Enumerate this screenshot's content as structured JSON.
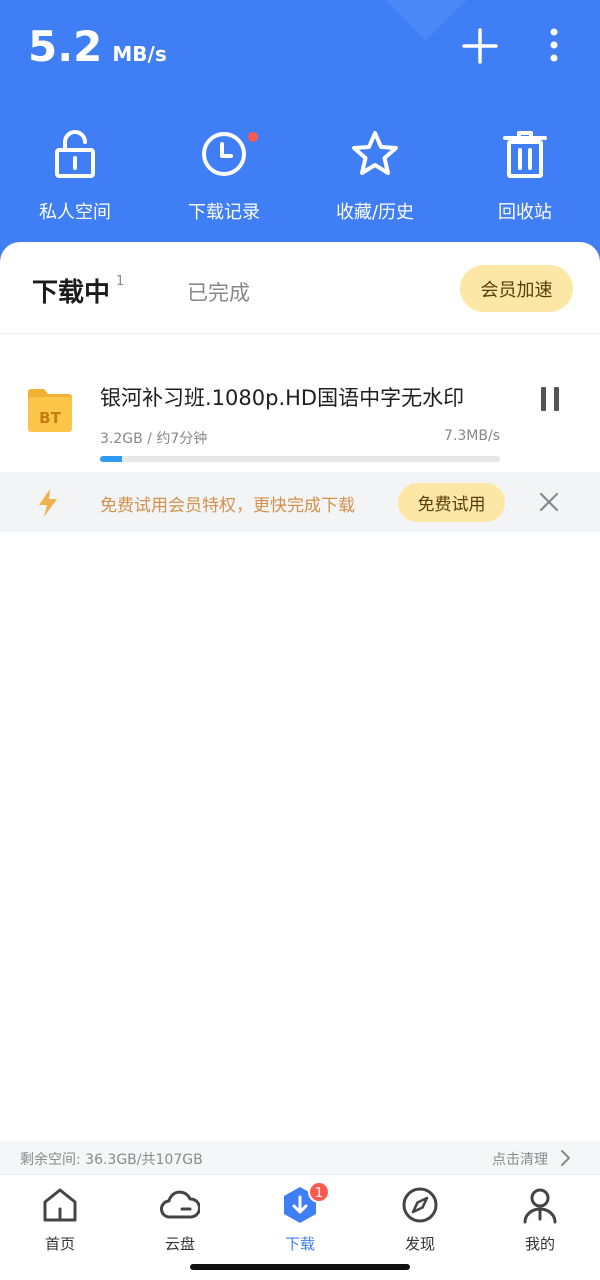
{
  "colors": {
    "primary": "#3f7ef5",
    "vip": "#fde7a6",
    "promo_text": "#d4914b",
    "badge": "#ff5a4f",
    "progress": "#2f9bf0"
  },
  "header": {
    "speed_value": "5.2",
    "speed_unit": "MB/s",
    "add_icon": "plus-icon",
    "more_icon": "more-vertical-icon"
  },
  "quick_actions": [
    {
      "label": "私人空间",
      "icon": "unlock-icon"
    },
    {
      "label": "下载记录",
      "icon": "clock-icon",
      "has_dot": true
    },
    {
      "label": "收藏/历史",
      "icon": "star-icon"
    },
    {
      "label": "回收站",
      "icon": "trash-icon"
    }
  ],
  "tabs": {
    "active_label": "下载中",
    "active_count": "1",
    "done_label": "已完成",
    "vip_button": "会员加速"
  },
  "task": {
    "icon_text": "BT",
    "name": "银河补习班.1080p.HD国语中字无水印",
    "size_eta": "3.2GB / 约7分钟",
    "speed": "7.3MB/s",
    "progress": 0.055
  },
  "promo": {
    "text": "免费试用会员特权，更快完成下载",
    "button": "免费试用"
  },
  "storage": {
    "text": "剩余空间: 36.3GB/共107GB",
    "clean": "点击清理"
  },
  "tabbar": [
    {
      "label": "首页",
      "icon": "home-icon"
    },
    {
      "label": "云盘",
      "icon": "cloud-icon"
    },
    {
      "label": "下载",
      "icon": "download-icon",
      "badge": "1",
      "active": true
    },
    {
      "label": "发现",
      "icon": "compass-icon"
    },
    {
      "label": "我的",
      "icon": "profile-icon"
    }
  ]
}
